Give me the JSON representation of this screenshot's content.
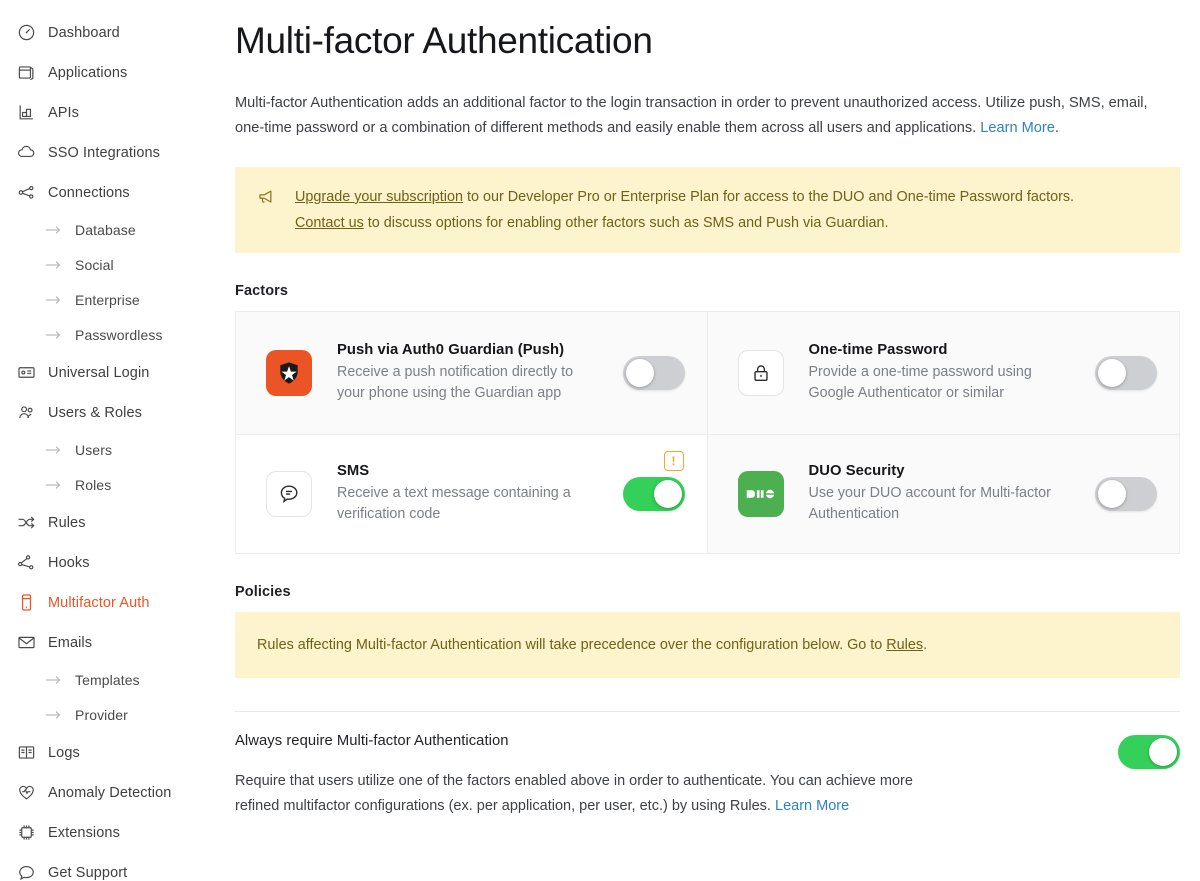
{
  "sidebar": {
    "items": [
      {
        "label": "Dashboard",
        "icon": "gauge-icon",
        "type": "item",
        "active": false
      },
      {
        "label": "Applications",
        "icon": "apps-icon",
        "type": "item",
        "active": false
      },
      {
        "label": "APIs",
        "icon": "apis-icon",
        "type": "item",
        "active": false
      },
      {
        "label": "SSO Integrations",
        "icon": "cloud-icon",
        "type": "item",
        "active": false
      },
      {
        "label": "Connections",
        "icon": "connections-icon",
        "type": "item",
        "active": false
      },
      {
        "label": "Database",
        "icon": "arrow-right-icon",
        "type": "sub"
      },
      {
        "label": "Social",
        "icon": "arrow-right-icon",
        "type": "sub"
      },
      {
        "label": "Enterprise",
        "icon": "arrow-right-icon",
        "type": "sub"
      },
      {
        "label": "Passwordless",
        "icon": "arrow-right-icon",
        "type": "sub"
      },
      {
        "label": "Universal Login",
        "icon": "id-card-icon",
        "type": "item",
        "active": false
      },
      {
        "label": "Users & Roles",
        "icon": "users-icon",
        "type": "item",
        "active": false
      },
      {
        "label": "Users",
        "icon": "arrow-right-icon",
        "type": "sub"
      },
      {
        "label": "Roles",
        "icon": "arrow-right-icon",
        "type": "sub"
      },
      {
        "label": "Rules",
        "icon": "rules-icon",
        "type": "item",
        "active": false
      },
      {
        "label": "Hooks",
        "icon": "hooks-icon",
        "type": "item",
        "active": false
      },
      {
        "label": "Multifactor Auth",
        "icon": "mobile-device-icon",
        "type": "item",
        "active": true
      },
      {
        "label": "Emails",
        "icon": "envelope-icon",
        "type": "item",
        "active": false
      },
      {
        "label": "Templates",
        "icon": "arrow-right-icon",
        "type": "sub"
      },
      {
        "label": "Provider",
        "icon": "arrow-right-icon",
        "type": "sub"
      },
      {
        "label": "Logs",
        "icon": "book-icon",
        "type": "item",
        "active": false
      },
      {
        "label": "Anomaly Detection",
        "icon": "heart-pulse-icon",
        "type": "item",
        "active": false
      },
      {
        "label": "Extensions",
        "icon": "chip-icon",
        "type": "item",
        "active": false
      },
      {
        "label": "Get Support",
        "icon": "chat-icon",
        "type": "item",
        "active": false
      }
    ],
    "active_color": "#eb5424"
  },
  "page": {
    "title": "Multi-factor Authentication",
    "description": "Multi-factor Authentication adds an additional factor to the login transaction in order to prevent unauthorized access. Utilize push, SMS, email, one-time password or a combination of different methods and easily enable them across all users and applications.",
    "description_link": "Learn More",
    "description_link_suffix": "."
  },
  "upgrade_banner": {
    "icon": "megaphone-icon",
    "line1_link": "Upgrade your subscription",
    "line1_text": " to our Developer Pro or Enterprise Plan for access to the DUO and One-time Password factors.",
    "line2_link": "Contact us",
    "line2_text": " to discuss options for enabling other factors such as SMS and Push via Guardian.",
    "background": "#fdf3cd",
    "text_color": "#6f6216"
  },
  "factors_section": {
    "label": "Factors",
    "items": [
      {
        "id": "push-guardian",
        "title": "Push via Auth0 Guardian (Push)",
        "description": "Receive a push notification directly to your phone using the Guardian app",
        "icon": "auth0-guardian-icon",
        "icon_bg": "#eb5424",
        "enabled": false,
        "warning": false,
        "card_bg": "#fafafa"
      },
      {
        "id": "one-time-password",
        "title": "One-time Password",
        "description": "Provide a one-time password using Google Authenticator or similar",
        "icon": "lock-icon",
        "icon_bg": "#ffffff",
        "enabled": false,
        "warning": false,
        "card_bg": "#fafafa"
      },
      {
        "id": "sms",
        "title": "SMS",
        "description": "Receive a text message containing a verification code",
        "icon": "sms-bubble-icon",
        "icon_bg": "#ffffff",
        "enabled": true,
        "warning": true,
        "warning_symbol": "!",
        "card_bg": "#ffffff"
      },
      {
        "id": "duo-security",
        "title": "DUO Security",
        "description": "Use your DUO account for Multi-factor Authentication",
        "icon": "duo-icon",
        "icon_bg": "#4caf50",
        "enabled": false,
        "warning": false,
        "card_bg": "#fafafa"
      }
    ]
  },
  "policies_section": {
    "label": "Policies",
    "banner_prefix": "Rules affecting Multi-factor Authentication will take precedence over the configuration below. Go to ",
    "banner_link": "Rules",
    "banner_suffix": "."
  },
  "always_require": {
    "title": "Always require Multi-factor Authentication",
    "description": "Require that users utilize one of the factors enabled above in order to authenticate. You can achieve more refined multifactor configurations (ex. per application, per user, etc.) by using Rules.",
    "description_link": "Learn More",
    "enabled": true
  },
  "colors": {
    "toggle_on": "#35d05a",
    "toggle_off": "#cdcfd2",
    "link": "#2f80c7",
    "warning": "#f0a82c"
  }
}
